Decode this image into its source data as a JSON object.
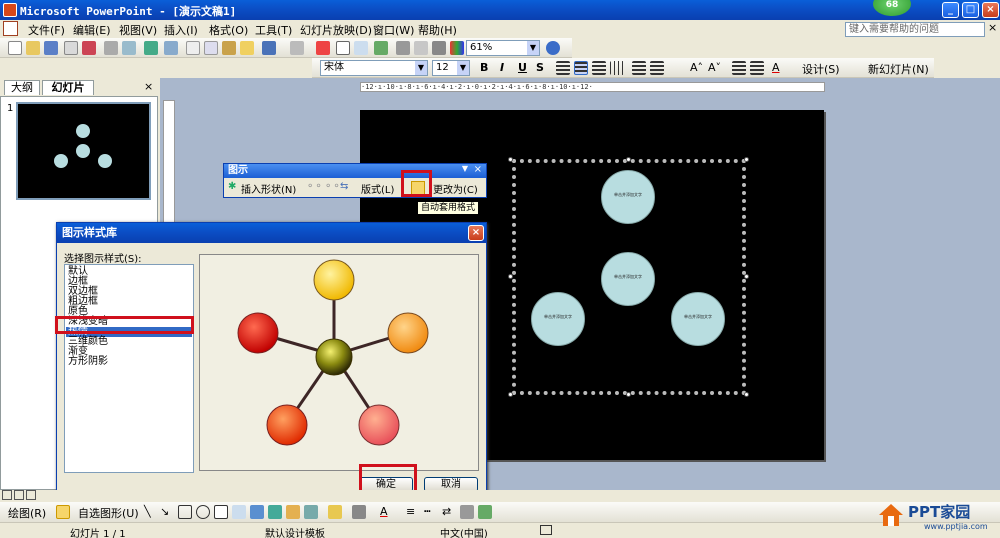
{
  "window": {
    "title": "Microsoft PowerPoint - [演示文稿1]",
    "badge": "68",
    "min": "_",
    "max": "□",
    "close": "×"
  },
  "menu": {
    "items": [
      "文件(F)",
      "编辑(E)",
      "视图(V)",
      "插入(I)",
      "格式(O)",
      "工具(T)",
      "幻灯片放映(D)",
      "窗口(W)",
      "帮助(H)"
    ],
    "help_placeholder": "键入需要帮助的问题",
    "doc_close": "×"
  },
  "standard_toolbar": {
    "zoom": "61%"
  },
  "format_toolbar": {
    "font": "宋体",
    "size": "12",
    "bold": "B",
    "italic": "I",
    "underline": "U",
    "shadow": "S",
    "design": "设计(S)",
    "new_slide": "新幻灯片(N)"
  },
  "left_panel": {
    "tab_outline": "大纲",
    "tab_slides": "幻灯片",
    "close": "×",
    "slide_number": "1"
  },
  "diagram_toolbar": {
    "title": "图示",
    "insert_shape": "插入形状(N)",
    "layout": "版式(L)",
    "change_to": "更改为(C)",
    "autoformat_tooltip": "自动套用格式"
  },
  "diagram": {
    "node_text": "单击并添加文字"
  },
  "dialog": {
    "title": "图示样式库",
    "label": "选择图示样式(S):",
    "styles": [
      "默认",
      "边框",
      "双边框",
      "粗边框",
      "原色",
      "深浅变暗",
      "热情",
      "三维颜色",
      "渐变",
      "方形阴影"
    ],
    "selected_index": 6,
    "ok": "确定",
    "cancel": "取消"
  },
  "status": {
    "slide": "幻灯片 1 / 1",
    "template": "默认设计模板",
    "language": "中文(中国)"
  },
  "drawing_toolbar": {
    "draw": "绘图(R)",
    "autoshapes": "自选图形(U)"
  },
  "watermark": {
    "brand": "PPT家园",
    "url": "www.pptjia.com"
  }
}
